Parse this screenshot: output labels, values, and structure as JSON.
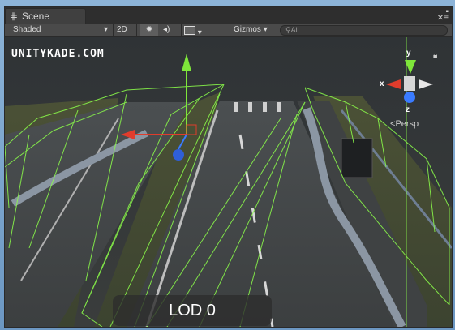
{
  "tab": {
    "icon": "grid-icon",
    "label": "Scene"
  },
  "toolbar": {
    "shading_mode": "Shaded",
    "mode_2d": "2D",
    "sun_icon": "sun-icon",
    "audio_icon": "speaker-icon",
    "image_icon": "image-icon",
    "gizmos": "Gizmos",
    "search_placeholder": "All"
  },
  "viewport": {
    "watermark": "UNITYKADE.COM",
    "persp_label": "Persp",
    "lod_label": "LOD 0",
    "gizmo_axes": {
      "x": "x",
      "y": "y",
      "z": "z"
    }
  },
  "colors": {
    "wireframe": "#8cff4a",
    "axis_y": "#7ee63a",
    "axis_x": "#e03c2c",
    "axis_z": "#3a7bff"
  }
}
